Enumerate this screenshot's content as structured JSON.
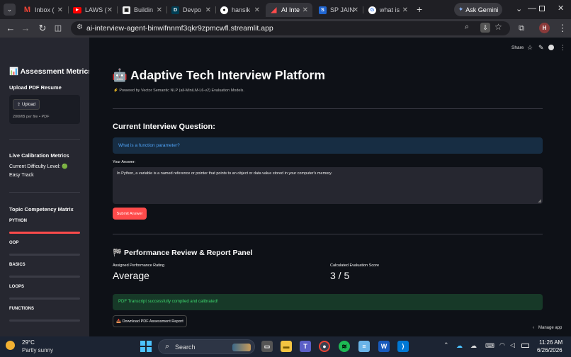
{
  "browser": {
    "tabs": [
      {
        "label": "Inbox (",
        "icon": "gmail-icon",
        "active": false
      },
      {
        "label": "LAWS (",
        "icon": "youtube-icon",
        "active": false
      },
      {
        "label": "Buildin",
        "icon": "notion-icon",
        "active": false
      },
      {
        "label": "Devpo",
        "icon": "devpost-icon",
        "active": false
      },
      {
        "label": "hansik",
        "icon": "github-icon",
        "active": false
      },
      {
        "label": "AI Inte",
        "icon": "streamlit-icon",
        "active": true
      },
      {
        "label": "SP JAIN",
        "icon": "sp-jain-icon",
        "active": false
      },
      {
        "label": "what is",
        "icon": "google-icon",
        "active": false
      }
    ],
    "new_tab": "+",
    "ask_gemini": "Ask Gemini",
    "url": "ai-interview-agent-binwifnnmf3qkr9zpmcwfl.streamlit.app",
    "profile_initial": "H"
  },
  "streamlit_toolbar": {
    "share": "Share"
  },
  "sidebar": {
    "title": "📊 Assessment Metrics",
    "upload_label": "Upload PDF Resume",
    "upload_button": "Upload",
    "upload_hint": "200MB per file • PDF",
    "calibration_title": "Live Calibration Metrics",
    "difficulty_text": "Current Difficulty Level: 🟢 Easy Track",
    "competency_title": "Topic Competency Matrix",
    "topics": [
      {
        "name": "PYTHON",
        "level": 1.0
      },
      {
        "name": "OOP",
        "level": 0.0
      },
      {
        "name": "BASICS",
        "level": 0.0
      },
      {
        "name": "LOOPS",
        "level": 0.0
      },
      {
        "name": "FUNCTIONS",
        "level": 0.0
      }
    ]
  },
  "main": {
    "title": "🤖 Adaptive Tech Interview Platform",
    "caption": "⚡ Powered by Vector Semantic NLP (all-MiniLM-L6-v2) Evaluation Models.",
    "question_header": "Current Interview Question:",
    "question": "What is a function parameter?",
    "answer_label": "Your Answer:",
    "answer_value": "In Python, a variable is a named reference or pointer that points to an object or data value stored in your computer's memory.",
    "submit_label": "Submit Answer",
    "review_header": "🏁 Performance Review & Report Panel",
    "rating_label": "Assigned Performance Rating",
    "rating_value": "Average",
    "score_label": "Calculated Evaluation Score",
    "score_value": "3 / 5",
    "success_message": "PDF Transcript successfully compiled and calibrated!",
    "download_label": "📥 Download PDF Assessment Report",
    "manage_app": "Manage app"
  },
  "taskbar": {
    "weather_temp": "29°C",
    "weather_desc": "Partly sunny",
    "search_placeholder": "Search",
    "time": "11:26 AM",
    "date": "6/26/2026"
  },
  "colors": {
    "accent_red": "#ff4b4b",
    "info_bg": "#172d43",
    "info_text": "#4fa3f7",
    "success_bg": "#173928",
    "success_text": "#3dd56d"
  }
}
